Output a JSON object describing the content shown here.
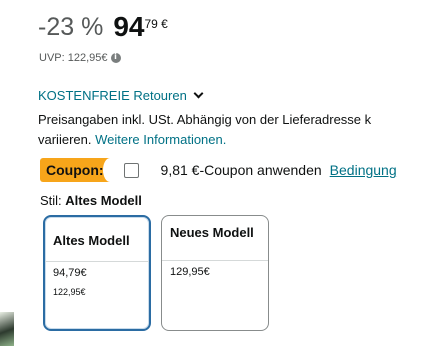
{
  "price": {
    "discount": "-23 %",
    "whole": "94",
    "fraction": "79 €",
    "uvp": "UVP: 122,95€"
  },
  "returns": {
    "label": "KOSTENFREIE Retouren"
  },
  "tax": {
    "line1": "Preisangaben inkl. USt. Abhängig von der Lieferadresse k",
    "line2_prefix": "variieren.",
    "link": "Weitere Informationen."
  },
  "coupon": {
    "badge": "Coupon:",
    "text": "9,81 €-Coupon anwenden",
    "link": "Bedingung"
  },
  "style": {
    "label": "Stil:",
    "value": "Altes Modell"
  },
  "options": [
    {
      "name": "Altes Modell",
      "price": "94,79€",
      "old_price": "122,95€",
      "selected": true
    },
    {
      "name": "Neues Modell",
      "price": "129,95€",
      "selected": false
    }
  ],
  "colors": {
    "link": "#007185",
    "coupon_badge": "#f7a51a",
    "selected_border": "#2b6ca3"
  }
}
